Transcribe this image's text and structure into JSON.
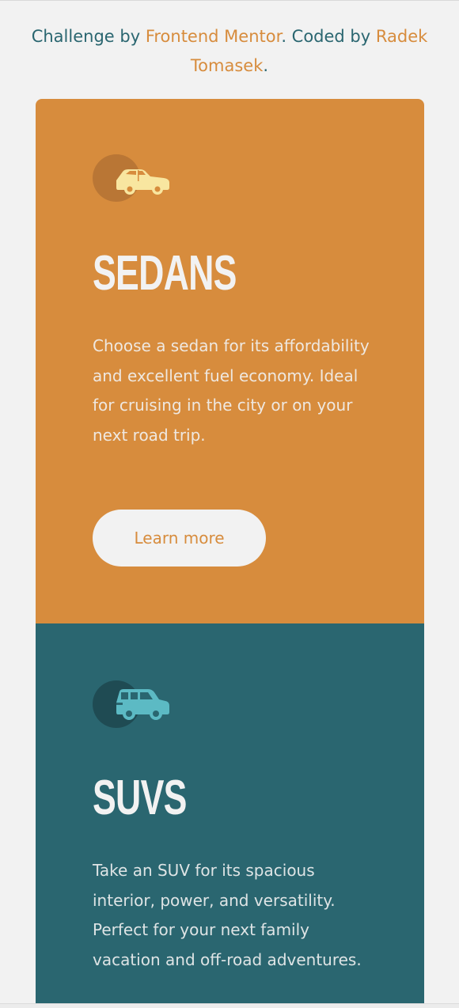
{
  "attribution": {
    "prefix": "Challenge by ",
    "challenge_link": "Frontend Mentor",
    "middle": ". Coded by ",
    "author_link": "Radek Tomasek",
    "suffix": "."
  },
  "cards": [
    {
      "icon": "sedan-car-icon",
      "title": "SEDANS",
      "description": "Choose a sedan for its affordability and excellent fuel economy. Ideal for cruising in the city or on your next road trip.",
      "button_label": "Learn more",
      "color": "#d78c3d"
    },
    {
      "icon": "suv-car-icon",
      "title": "SUVS",
      "description": "Take an SUV for its spacious interior, power, and versatility. Perfect for your next family vacation and off-road adventures.",
      "color": "#2a6670"
    }
  ],
  "colors": {
    "background": "#f2f2f2",
    "accent_orange": "#d78c3d",
    "accent_teal": "#2a6670",
    "icon_yellow": "#f8e6a0",
    "icon_cyan": "#5cbac4"
  }
}
